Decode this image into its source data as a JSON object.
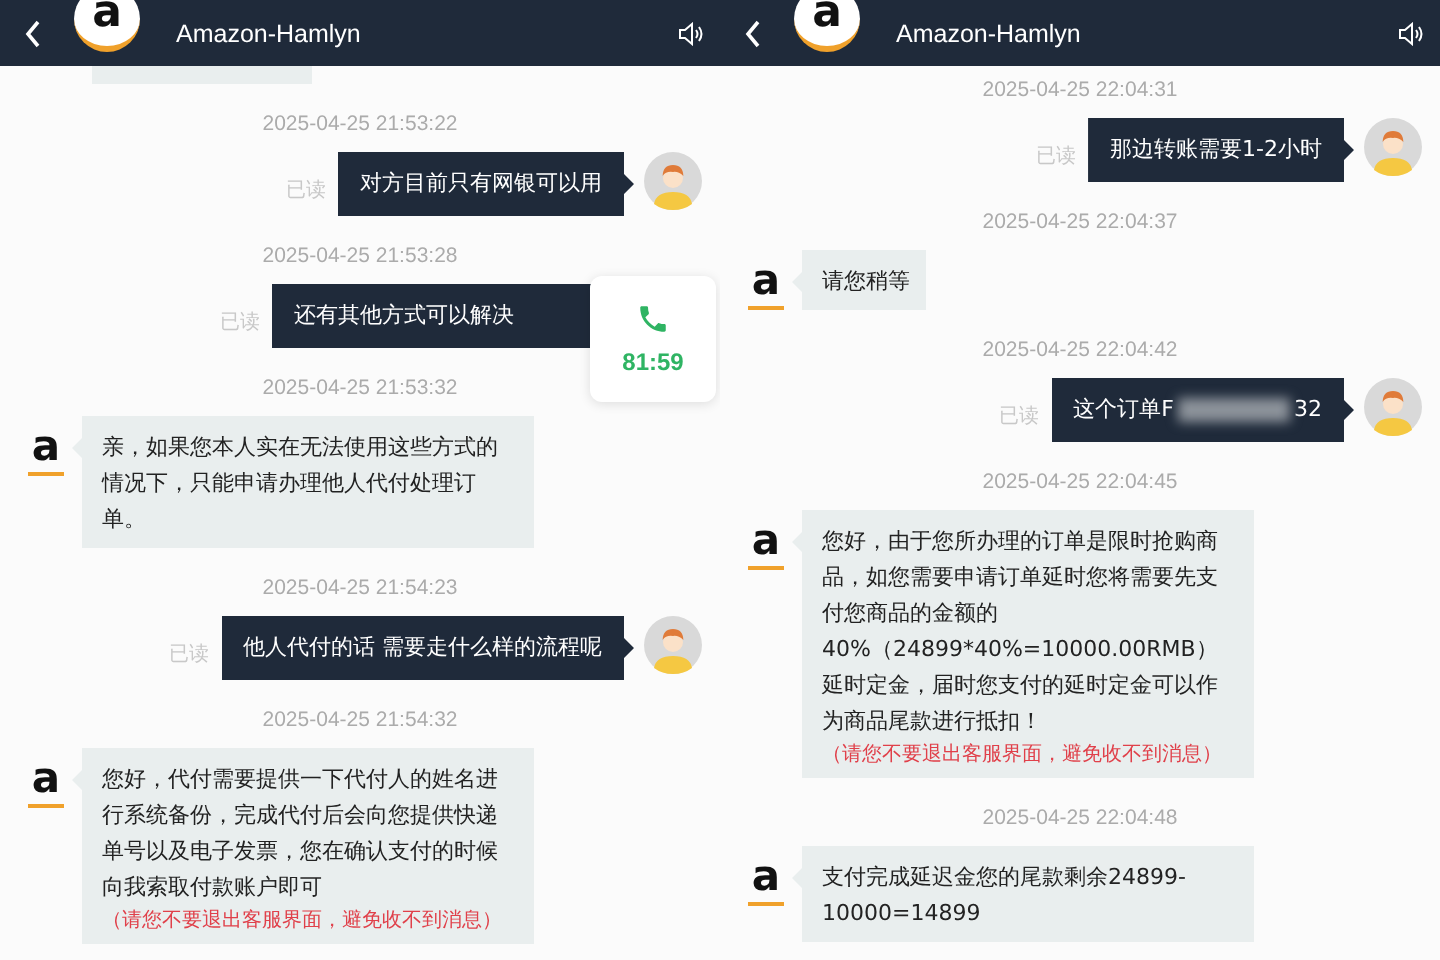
{
  "panels": [
    {
      "header": {
        "title": "Amazon-Hamlyn",
        "logo_letter": "a"
      },
      "call_widget": {
        "timer": "81:59"
      },
      "messages": [
        {
          "kind": "clipped"
        },
        {
          "kind": "sent",
          "time": "2025-04-25 21:53:22",
          "status": "已读",
          "text": "对方目前只有网银可以用"
        },
        {
          "kind": "sent",
          "time": "2025-04-25 21:53:28",
          "status": "已读",
          "text": "还有其他方式可以解决",
          "under_call": true
        },
        {
          "kind": "received",
          "time": "2025-04-25 21:53:32",
          "logo_letter": "a",
          "text": "亲，如果您本人实在无法使用这些方式的情况下，只能申请办理他人代付处理订单。"
        },
        {
          "kind": "sent",
          "time": "2025-04-25 21:54:23",
          "status": "已读",
          "text": "他人代付的话 需要走什么样的流程呢"
        },
        {
          "kind": "received",
          "time": "2025-04-25 21:54:32",
          "logo_letter": "a",
          "text": "您好，代付需要提供一下代付人的姓名进行系统备份，完成代付后会向您提供快递单号以及电子发票，您在确认支付的时候向我索取付款账户即可",
          "notice": "（请您不要退出客服界面，避免收不到消息）"
        }
      ]
    },
    {
      "header": {
        "title": "Amazon-Hamlyn",
        "logo_letter": "a"
      },
      "messages": [
        {
          "kind": "sent",
          "time": "2025-04-25 22:04:31",
          "status": "已读",
          "text": "那边转账需要1-2小时"
        },
        {
          "kind": "received",
          "time": "2025-04-25 22:04:37",
          "logo_letter": "a",
          "text": "请您稍等"
        },
        {
          "kind": "sent",
          "time": "2025-04-25 22:04:42",
          "status": "已读",
          "text": "这个订单F",
          "redacted": true,
          "text_after": "32"
        },
        {
          "kind": "received",
          "time": "2025-04-25 22:04:45",
          "logo_letter": "a",
          "text": "您好，由于您所办理的订单是限时抢购商品，如您需要申请订单延时您将需要先支付您商品的金额的40%（24899*40%=10000.00RMB）延时定金，届时您支付的延时定金可以作为商品尾款进行抵扣！",
          "notice": "（请您不要退出客服界面，避免收不到消息）"
        },
        {
          "kind": "received",
          "time": "2025-04-25 22:04:48",
          "logo_letter": "a",
          "text": "支付完成延迟金您的尾款剩余24899-10000=14899"
        }
      ]
    }
  ]
}
